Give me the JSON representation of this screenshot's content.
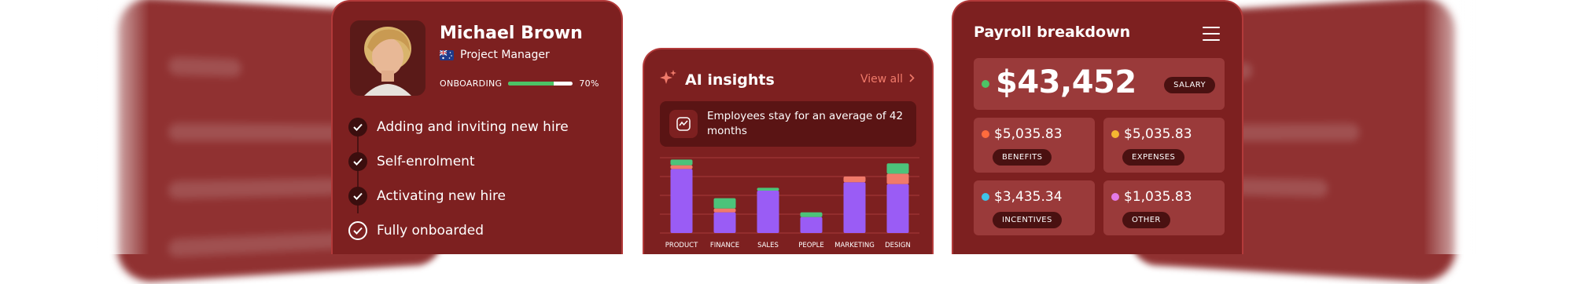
{
  "profile": {
    "name": "Michael Brown",
    "role": "Project Manager",
    "onboarding_label": "ONBOARDING",
    "onboarding_percent_label": "70%",
    "onboarding_fraction": 0.7,
    "steps": [
      {
        "label": "Adding and inviting new hire",
        "state": "done"
      },
      {
        "label": "Self-enrolment",
        "state": "done"
      },
      {
        "label": "Activating new hire",
        "state": "done"
      },
      {
        "label": "Fully onboarded",
        "state": "final"
      }
    ]
  },
  "insights": {
    "title": "AI insights",
    "view_all": "View all",
    "message": "Employees stay for an average of 42 months"
  },
  "chart_data": {
    "type": "bar",
    "stacked": true,
    "categories": [
      "PRODUCT",
      "FINANCE",
      "SALES",
      "PEOPLE",
      "MARKETING",
      "DESIGN"
    ],
    "series": [
      {
        "color": "#9a5cf5",
        "values": [
          68,
          22,
          45,
          17,
          54,
          52
        ]
      },
      {
        "color": "#f07a6a",
        "values": [
          4,
          4,
          0,
          0,
          6,
          11
        ]
      },
      {
        "color": "#4cc37a",
        "values": [
          6,
          11,
          3,
          5,
          0,
          11
        ]
      }
    ],
    "ylim": [
      0,
      80
    ],
    "grid": true
  },
  "payroll": {
    "title": "Payroll breakdown",
    "total": "$43,452",
    "total_tag": "SALARY",
    "total_color": "#4cc365",
    "items": [
      {
        "amount": "$5,035.83",
        "tag": "BENEFITS",
        "color": "#ff6b3d"
      },
      {
        "amount": "$5,035.83",
        "tag": "EXPENSES",
        "color": "#f5b731"
      },
      {
        "amount": "$3,435.34",
        "tag": "INCENTIVES",
        "color": "#3ec3e8"
      },
      {
        "amount": "$1,035.83",
        "tag": "OTHER",
        "color": "#e37ae6"
      }
    ]
  }
}
